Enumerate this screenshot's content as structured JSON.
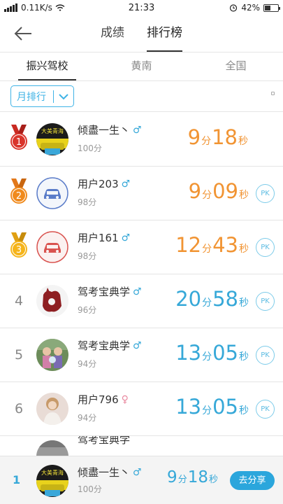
{
  "status": {
    "carrier_speed": "0.11K/s",
    "time": "21:33",
    "battery": "42%",
    "battery_level": 0.42
  },
  "header": {
    "tabs": [
      {
        "label": "成绩"
      },
      {
        "label": "排行榜"
      }
    ],
    "active_tab": 1
  },
  "subtabs": [
    {
      "label": "振兴驾校"
    },
    {
      "label": "黄南"
    },
    {
      "label": "全国"
    }
  ],
  "filter": {
    "label": "月排行"
  },
  "rows": [
    {
      "rank": "1",
      "name": "倾盡一生丶",
      "gender": "♂",
      "score": "100分",
      "min": "9",
      "min_unit": "分",
      "sec": "18",
      "sec_unit": "秒",
      "pk": ""
    },
    {
      "rank": "2",
      "name": "用户203",
      "gender": "♂",
      "score": "98分",
      "min": "9",
      "min_unit": "分",
      "sec": "09",
      "sec_unit": "秒",
      "pk": "PK"
    },
    {
      "rank": "3",
      "name": "用户161",
      "gender": "♂",
      "score": "98分",
      "min": "12",
      "min_unit": "分",
      "sec": "43",
      "sec_unit": "秒",
      "pk": "PK"
    },
    {
      "rank": "4",
      "name": "驾考宝典学",
      "gender": "♂",
      "score": "96分",
      "min": "20",
      "min_unit": "分",
      "sec": "58",
      "sec_unit": "秒",
      "pk": "PK"
    },
    {
      "rank": "5",
      "name": "驾考宝典学",
      "gender": "♂",
      "score": "94分",
      "min": "13",
      "min_unit": "分",
      "sec": "05",
      "sec_unit": "秒",
      "pk": "PK"
    },
    {
      "rank": "6",
      "name": "用户796",
      "gender": "♀",
      "score": "94分",
      "min": "13",
      "min_unit": "分",
      "sec": "05",
      "sec_unit": "秒",
      "pk": "PK"
    },
    {
      "rank": "",
      "name": "驾考宝典学",
      "gender": "",
      "score": "",
      "min": "",
      "min_unit": "",
      "sec": "",
      "sec_unit": "",
      "pk": ""
    }
  ],
  "footer": {
    "rank": "1",
    "name": "倾盡一生丶",
    "gender": "♂",
    "score": "100分",
    "min": "9",
    "min_unit": "分",
    "sec": "18",
    "sec_unit": "秒",
    "share": "去分享"
  },
  "colors": {
    "accent": "#36a8d8",
    "orange": "#f19433",
    "gold": "#f5b41a",
    "red": "#d9342b",
    "orange_medal": "#f08a1c"
  }
}
